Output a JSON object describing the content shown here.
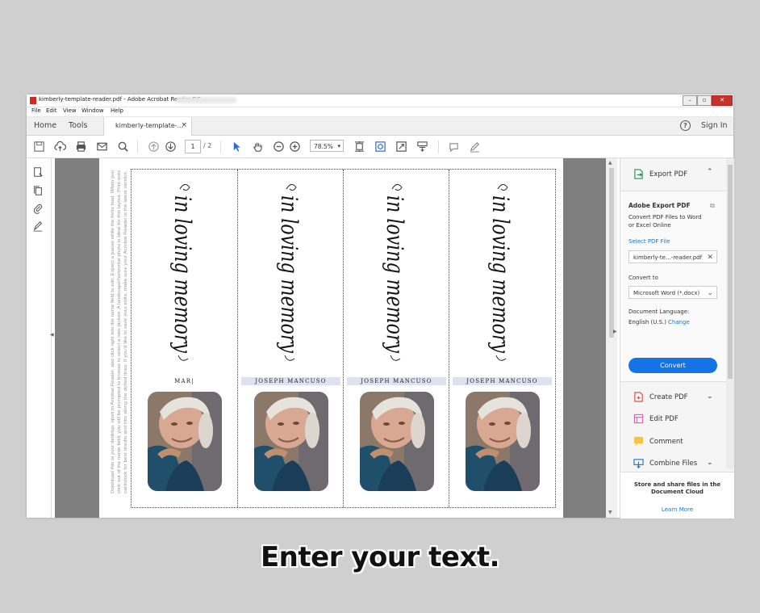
{
  "window": {
    "title": "kimberly-template-reader.pdf - Adobe Acrobat Reader DC",
    "minimize": "–",
    "maximize": "▫",
    "close": "✕"
  },
  "menu": [
    "File",
    "Edit",
    "View",
    "Window",
    "Help"
  ],
  "tabs": {
    "home": "Home",
    "tools": "Tools",
    "document": "kimberly-template-...",
    "close": "×",
    "help": "?",
    "sign_in": "Sign In"
  },
  "toolbar": {
    "page_current": "1",
    "page_total": "/ 2",
    "zoom": "78.5%",
    "zoom_caret": "▾"
  },
  "document": {
    "instructions": "Download this to your desktop, open in Acrobat Reader, and click right into the name field to edit. Expect a pause while the fonts load. When you click out of the name field, you will be prompted to browse to select a new picture. A landscape/horizontal photo is ideal for this layout. Print onto cardstock for best results and trim along the dotted lines. If you'd like to save your edits, make sure your Acrobat Reader is the latest version.",
    "script_text": "in loving memory",
    "cards": [
      {
        "name": "MAR|",
        "highlight": false
      },
      {
        "name": "JOSEPH MANCUSO",
        "highlight": true
      },
      {
        "name": "JOSEPH MANCUSO",
        "highlight": true
      },
      {
        "name": "JOSEPH MANCUSO",
        "highlight": true
      }
    ]
  },
  "right_panel": {
    "export_pdf": "Export PDF",
    "adobe_export_pdf": "Adobe Export PDF",
    "description": [
      "Convert PDF Files to Word",
      "or Excel Online"
    ],
    "select_pdf_file": "Select PDF File",
    "selected_file": "kimberly-te...-reader.pdf",
    "convert_to": "Convert to",
    "format": "Microsoft Word (*.docx)",
    "document_language": "Document Language:",
    "language": "English (U.S.)",
    "change": "Change",
    "convert": "Convert",
    "tools": [
      {
        "label": "Create PDF",
        "chevron": true
      },
      {
        "label": "Edit PDF",
        "chevron": false
      },
      {
        "label": "Comment",
        "chevron": false
      },
      {
        "label": "Combine Files",
        "chevron": true
      }
    ],
    "footer_text": [
      "Store and share files in the",
      "Document Cloud"
    ],
    "learn_more": "Learn More"
  },
  "caption": "Enter your text.",
  "colors": {
    "accent": "#1473e6",
    "name_highlight": "#dde2ef",
    "document_bg": "#7f7f7f"
  },
  "icons": [
    "save-icon",
    "upload-icon",
    "print-icon",
    "mail-icon",
    "search-icon",
    "page-up-icon",
    "page-down-icon",
    "select-cursor-icon",
    "hand-icon",
    "zoom-out-icon",
    "zoom-in-icon",
    "fit-page-icon",
    "scan-icon",
    "full-screen-icon",
    "read-mode-icon",
    "comment-icon",
    "pen-icon"
  ]
}
